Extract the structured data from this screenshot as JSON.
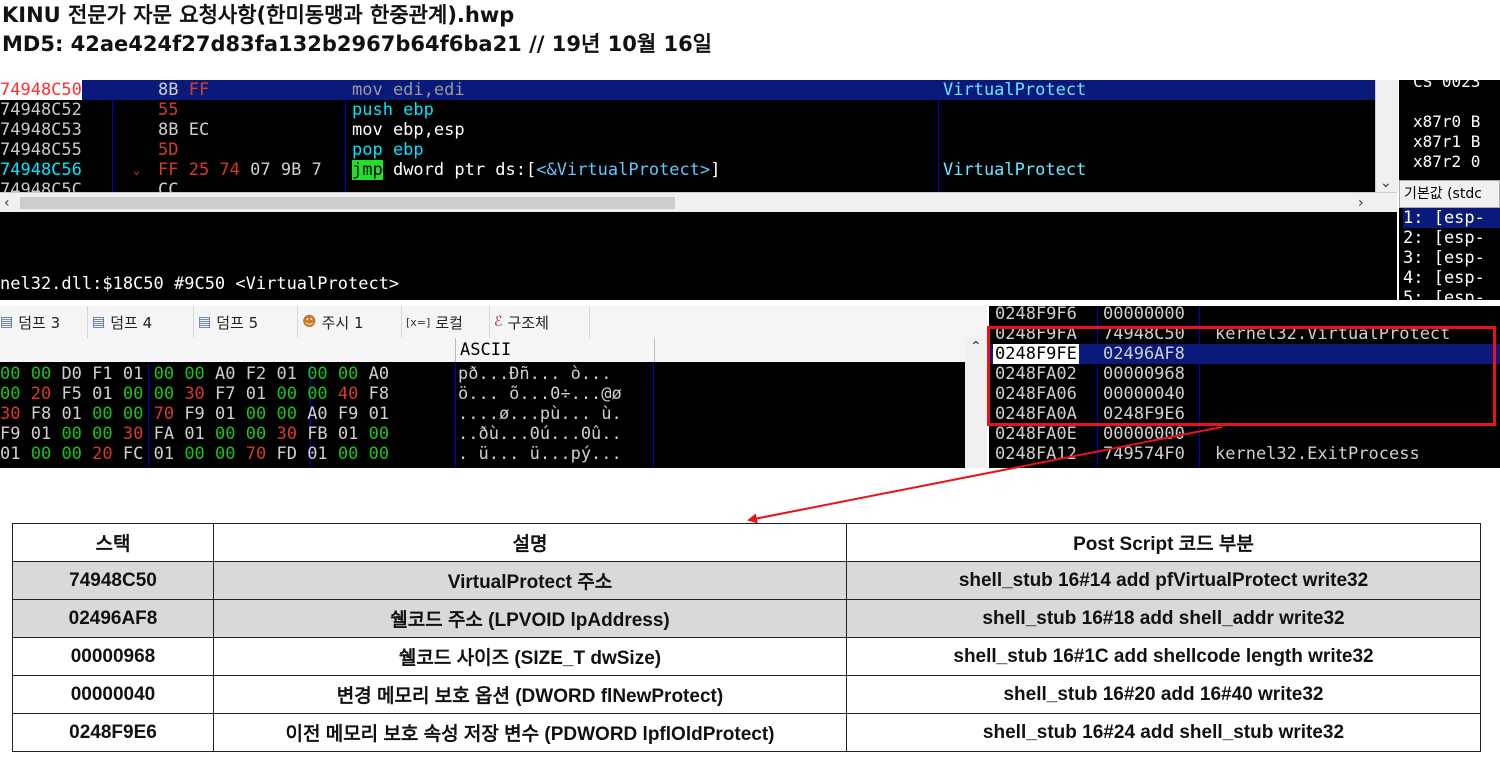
{
  "header": {
    "title": "KINU 전문가 자문 요청사항(한미동맹과 한중관계).hwp",
    "md5": "MD5: 42ae424f27d83fa132b2967b64f6ba21 // 19년 10월 16일"
  },
  "disasm": {
    "rows": [
      {
        "addr": "74948C50",
        "bytes": "8B FF",
        "instr": "mov edi,edi",
        "comment": "VirtualProtect",
        "selected": true
      },
      {
        "addr": "74948C52",
        "bytes": "55",
        "instr": "push ebp",
        "comment": "",
        "selected": false
      },
      {
        "addr": "74948C53",
        "bytes": "8B EC",
        "instr": "mov ebp,esp",
        "comment": "",
        "selected": false
      },
      {
        "addr": "74948C55",
        "bytes": "5D",
        "instr": "pop ebp",
        "comment": "",
        "selected": false
      },
      {
        "addr": "74948C56",
        "bytes": "FF 25 74 07 9B 7",
        "instr": "jmp dword ptr ds:[<&VirtualProtect>]",
        "comment": "VirtualProtect",
        "selected": false
      },
      {
        "addr": "74948C5C",
        "bytes": "CC",
        "instr": "",
        "comment": "",
        "selected": false
      }
    ],
    "jmp_mnemonic": "jmp",
    "jmp_operand": " dword ptr ds:[",
    "jmp_target": "<&VirtualProtect>",
    "jmp_close": "]",
    "info_line": "nel32.dll:$18C50 #9C50 <VirtualProtect>"
  },
  "registers": {
    "segment": "CS 0023",
    "rows": [
      "x87r0 B",
      "x87r1 B",
      "x87r2 0"
    ],
    "callconv": "기본값 (stdc",
    "args": [
      "1: [esp-",
      "2: [esp-",
      "3: [esp-",
      "4: [esp-",
      "5: [esp-"
    ]
  },
  "dump_tabs": [
    {
      "icon": "dump-icon",
      "glyph": "▤",
      "label": "덤프 3"
    },
    {
      "icon": "dump-icon",
      "glyph": "▤",
      "label": "덤프 4"
    },
    {
      "icon": "dump-icon",
      "glyph": "▤",
      "label": "덤프 5"
    },
    {
      "icon": "watch-icon",
      "glyph": "☻",
      "label": "주시 1"
    },
    {
      "icon": "locals-icon",
      "glyph": "[x=]",
      "label": "로컬"
    },
    {
      "icon": "struct-icon",
      "glyph": "ℰ",
      "label": "구조체"
    }
  ],
  "dump": {
    "ascii_header": "ASCII",
    "rows": [
      {
        "hex": "00 00 D0 F1 01 00 00 A0 F2 01 00 00 A0",
        "ascii": "pð...Ðñ... ò..."
      },
      {
        "hex": "00 20 F5 01 00 00 30 F7 01 00 00 40 F8",
        "ascii": "ö... õ...0÷...@ø"
      },
      {
        "hex": "30 F8 01 00 00 70 F9 01 00 00 A0 F9 01",
        "ascii": "....ø...pù... ù."
      },
      {
        "hex": "F9 01 00 00 30 FA 01 00 00 30 FB 01 00",
        "ascii": "..ðù...0ú...0û.."
      },
      {
        "hex": "01 00 00 20 FC 01 00 00 70 FD 01 00 00",
        "ascii": ". ü... ü...pý..."
      }
    ]
  },
  "stack": {
    "rows": [
      {
        "addr": "0248F9F6",
        "value": "00000000",
        "comment": ""
      },
      {
        "addr": "0248F9FA",
        "value": "74948C50",
        "comment": "kernel32.VirtualProtect"
      },
      {
        "addr": "0248F9FE",
        "value": "02496AF8",
        "comment": ""
      },
      {
        "addr": "0248FA02",
        "value": "00000968",
        "comment": ""
      },
      {
        "addr": "0248FA06",
        "value": "00000040",
        "comment": ""
      },
      {
        "addr": "0248FA0A",
        "value": "0248F9E6",
        "comment": ""
      },
      {
        "addr": "0248FA0E",
        "value": "00000000",
        "comment": ""
      },
      {
        "addr": "0248FA12",
        "value": "749574F0",
        "comment": "kernel32.ExitProcess"
      }
    ],
    "selected_index": 2
  },
  "table": {
    "headers": [
      "스택",
      "설명",
      "Post Script 코드 부분"
    ],
    "rows": [
      {
        "stack": "74948C50",
        "desc": "VirtualProtect 주소",
        "code": "shell_stub 16#14 add pfVirtualProtect write32"
      },
      {
        "stack": "02496AF8",
        "desc": "쉘코드 주소 (LPVOID lpAddress)",
        "code": "shell_stub 16#18 add shell_addr write32"
      },
      {
        "stack": "00000968",
        "desc": "쉘코드 사이즈 (SIZE_T dwSize)",
        "code": "shell_stub 16#1C add shellcode length write32"
      },
      {
        "stack": "00000040",
        "desc": "변경 메모리 보호 옵션 (DWORD  flNewProtect)",
        "code": "shell_stub 16#20 add 16#40 write32"
      },
      {
        "stack": "0248F9E6",
        "desc": "이전 메모리 보호 속성 저장 변수 (PDWORD lpflOldProtect)",
        "code": "shell_stub 16#24 add shell_stub write32"
      }
    ]
  },
  "colors": {
    "addr_red": "#ff3030",
    "addr_cyan": "#00e5ff",
    "bytes_red": "#d83a2a",
    "bytes_green": "#16b016",
    "zero_green": "#19c419",
    "selection": "#0a1a7a",
    "jmp_bg": "#22e02a",
    "highlight_box": "#e8121a"
  }
}
